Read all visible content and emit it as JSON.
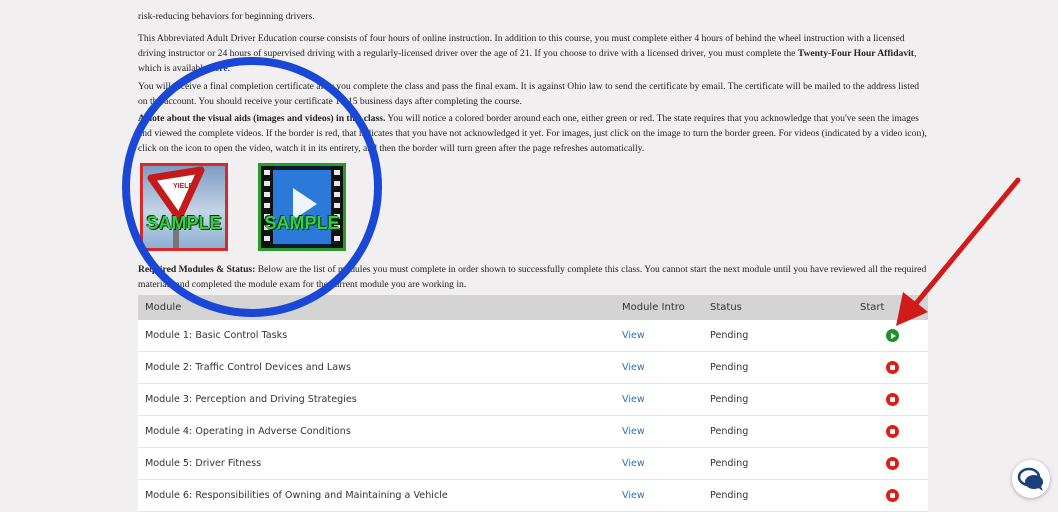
{
  "paragraphs": {
    "p0": "risk-reducing behaviors for beginning drivers.",
    "p1a": "This Abbreviated Adult Driver Education course consists of four hours of online instruction. In addition to this course, you must complete either 4 hours of behind the wheel instruction with a licensed driving instructor or 24 hours of supervised driving with a regularly-licensed driver over the age of 21. If you choose to drive with a licensed driver, you must complete the ",
    "p1b": "Twenty-Four Hour Affidavit",
    "p1c": ", which is available ",
    "p1link": "here",
    "p1d": ".",
    "p2": "You will receive a final completion certificate after you complete the class and pass the final exam. It is against Ohio law to send the certificate by email. The certificate will be mailed to the address listed on the account. You should receive your certificate 10-15 business days after completing the course.",
    "p3a": "A note about the visual aids (images and videos) in this class.",
    "p3b": " You will notice a colored border around each one, either green or red. The state requires that you acknowledge that you've seen the images and viewed the complete videos. If the border is red, that indicates that you have not acknowledged it yet. For images, just click on the image to turn the border green. For videos (indicated by a video icon), click on the icon to open the video, watch it in its entirety, and then the border will turn green after the page refreshes automatically.",
    "p4a": "Required Modules & Status:",
    "p4b": " Below are the list of modules you must complete in order shown to successfully complete this class. You cannot start the next module until you have reviewed all the required materials and completed the module exam for the current module you are working in."
  },
  "samples": {
    "image_label": "SAMPLE",
    "video_label": "SAMPLE",
    "sign_text": "YIELD"
  },
  "table": {
    "headers": {
      "module": "Module",
      "intro": "Module Intro",
      "status": "Status",
      "start": "Start"
    },
    "rows": [
      {
        "module": "Module 1: Basic Control Tasks",
        "intro": "View",
        "status": "Pending",
        "start": "play"
      },
      {
        "module": "Module 2: Traffic Control Devices and Laws",
        "intro": "View",
        "status": "Pending",
        "start": "stop"
      },
      {
        "module": "Module 3: Perception and Driving Strategies",
        "intro": "View",
        "status": "Pending",
        "start": "stop"
      },
      {
        "module": "Module 4: Operating in Adverse Conditions",
        "intro": "View",
        "status": "Pending",
        "start": "stop"
      },
      {
        "module": "Module 5: Driver Fitness",
        "intro": "View",
        "status": "Pending",
        "start": "stop"
      },
      {
        "module": "Module 6: Responsibilities of Owning and Maintaining a Vehicle",
        "intro": "View",
        "status": "Pending",
        "start": "stop"
      }
    ]
  },
  "icons": {
    "chat": "chat-bubbles-icon",
    "start_play": "play-circle-icon",
    "start_stop": "stop-circle-icon",
    "video": "video-play-icon"
  },
  "colors": {
    "play": "#1f8f2a",
    "stop": "#dd1c1c",
    "link": "#2d6fb8",
    "annotation": "#1b47d6",
    "arrow": "#d11a1a"
  }
}
